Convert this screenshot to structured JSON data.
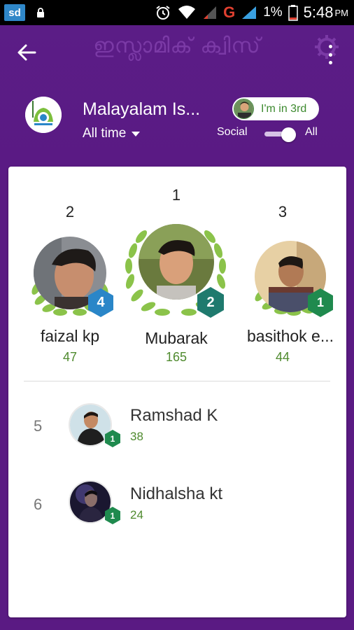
{
  "status_bar": {
    "app_badge": "sd",
    "network": "G",
    "battery": "1%",
    "time": "5:48",
    "ampm": "PM"
  },
  "app_bar": {
    "title": "ഇസ്ലാമിക് ക്വിസ്"
  },
  "leaderboard": {
    "title": "Malayalam Is...",
    "period": "All time",
    "my_rank_label": "I'm in 3rd",
    "filter_left": "Social",
    "filter_right": "All",
    "toggle_state": "All"
  },
  "podium": [
    {
      "place": "2",
      "name": "faizal kp",
      "score": "47",
      "level": "4",
      "level_color": "#2a86c8"
    },
    {
      "place": "1",
      "name": "Mubarak",
      "score": "165",
      "level": "2",
      "level_color": "#1f7a6e"
    },
    {
      "place": "3",
      "name": "basithok e...",
      "score": "44",
      "level": "1",
      "level_color": "#1f8a4e"
    }
  ],
  "list": [
    {
      "rank": "5",
      "name": "Ramshad K",
      "score": "38",
      "level": "1"
    },
    {
      "rank": "6",
      "name": "Nidhalsha kt",
      "score": "24",
      "level": "1"
    }
  ],
  "colors": {
    "primary": "#5a1a84",
    "score_green": "#4f8a2e",
    "laurel": "#8bc34a"
  }
}
